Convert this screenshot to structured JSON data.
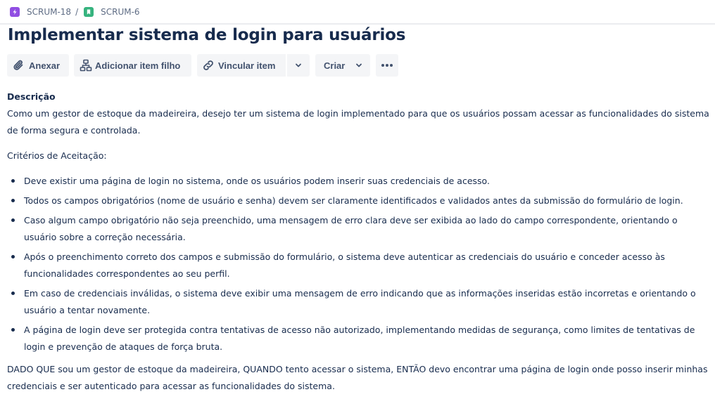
{
  "breadcrumb": {
    "items": [
      {
        "label": "SCRUM-18",
        "icon": "epic-icon",
        "color": "#904EE2"
      },
      {
        "label": "SCRUM-6",
        "icon": "story-icon",
        "color": "#36B37E"
      }
    ],
    "separator": "/"
  },
  "issue": {
    "title": "Implementar sistema de login para usuários"
  },
  "toolbar": {
    "attach_label": "Anexar",
    "add_child_label": "Adicionar item filho",
    "link_label": "Vincular item",
    "create_label": "Criar",
    "more_icon": "more-icon"
  },
  "description": {
    "heading": "Descrição",
    "intro": "Como um gestor de estoque da madeireira, desejo ter um sistema de login implementado para que os usuários possam acessar as funcionalidades do sistema de forma segura e controlada.",
    "criteria_heading": "Critérios de Aceitação:",
    "criteria": [
      "Deve existir uma página de login no sistema, onde os usuários podem inserir suas credenciais de acesso.",
      "Todos os campos obrigatórios (nome de usuário e senha) devem ser claramente identificados e validados antes da submissão do formulário de login.",
      "Caso algum campo obrigatório não seja preenchido, uma mensagem de erro clara deve ser exibida ao lado do campo correspondente, orientando o usuário sobre a correção necessária.",
      "Após o preenchimento correto dos campos e submissão do formulário, o sistema deve autenticar as credenciais do usuário e conceder acesso às funcionalidades correspondentes ao seu perfil.",
      "Em caso de credenciais inválidas, o sistema deve exibir uma mensagem de erro indicando que as informações inseridas estão incorretas e orientando o usuário a tentar novamente.",
      "A página de login deve ser protegida contra tentativas de acesso não autorizado, implementando medidas de segurança, como limites de tentativas de login e prevenção de ataques de força bruta."
    ],
    "given_when_then": "DADO QUE sou um gestor de estoque da madeireira, QUANDO tento acessar o sistema, ENTÃO devo encontrar uma página de login onde posso inserir minhas credenciais e ser autenticado para acessar as funcionalidades do sistema."
  }
}
